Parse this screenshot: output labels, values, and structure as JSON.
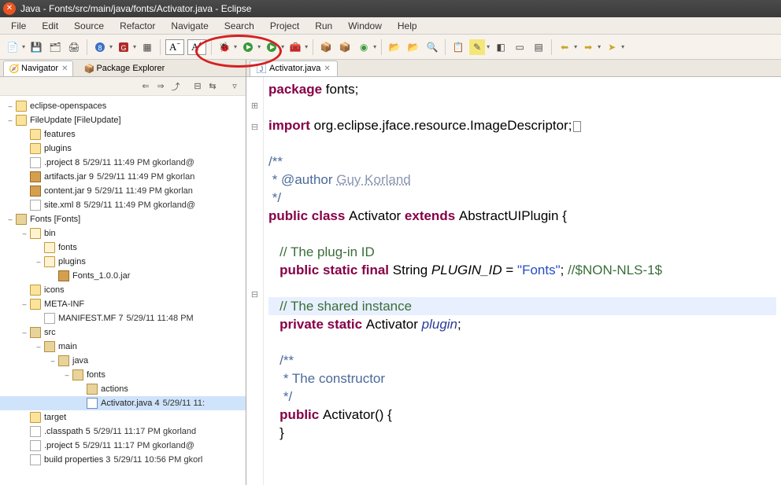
{
  "window": {
    "title": "Java - Fonts/src/main/java/fonts/Activator.java - Eclipse"
  },
  "menu": [
    "File",
    "Edit",
    "Source",
    "Refactor",
    "Navigate",
    "Search",
    "Project",
    "Run",
    "Window",
    "Help"
  ],
  "views": {
    "navigator": "Navigator",
    "package_explorer": "Package Explorer"
  },
  "editor_tab": {
    "label": "Activator.java"
  },
  "tree": [
    {
      "d": 0,
      "tw": "–",
      "ic": "folder",
      "label": "eclipse-openspaces"
    },
    {
      "d": 0,
      "tw": "–",
      "ic": "folder",
      "label": "FileUpdate [FileUpdate]"
    },
    {
      "d": 1,
      "tw": "",
      "ic": "folder",
      "label": "features"
    },
    {
      "d": 1,
      "tw": "",
      "ic": "folder",
      "label": "plugins"
    },
    {
      "d": 1,
      "tw": "",
      "ic": "file",
      "label": ".project 8",
      "meta": "5/29/11 11:49 PM  gkorland@"
    },
    {
      "d": 1,
      "tw": "",
      "ic": "jar",
      "label": "artifacts.jar 9",
      "meta": "5/29/11 11:49 PM  gkorlan"
    },
    {
      "d": 1,
      "tw": "",
      "ic": "jar",
      "label": "content.jar 9",
      "meta": "5/29/11 11:49 PM  gkorlan"
    },
    {
      "d": 1,
      "tw": "",
      "ic": "file",
      "label": "site.xml 8",
      "meta": "5/29/11 11:49 PM  gkorland@"
    },
    {
      "d": 0,
      "tw": "–",
      "ic": "pkg",
      "label": "Fonts [Fonts]"
    },
    {
      "d": 1,
      "tw": "–",
      "ic": "folder open",
      "label": "bin"
    },
    {
      "d": 2,
      "tw": "",
      "ic": "folder open",
      "label": "fonts"
    },
    {
      "d": 2,
      "tw": "–",
      "ic": "folder open",
      "label": "plugins"
    },
    {
      "d": 3,
      "tw": "",
      "ic": "jar",
      "label": "Fonts_1.0.0.jar"
    },
    {
      "d": 1,
      "tw": "",
      "ic": "folder",
      "label": "icons"
    },
    {
      "d": 1,
      "tw": "–",
      "ic": "folder",
      "label": "META-INF"
    },
    {
      "d": 2,
      "tw": "",
      "ic": "file",
      "label": "MANIFEST.MF 7",
      "meta": "5/29/11 11:48 PM"
    },
    {
      "d": 1,
      "tw": "–",
      "ic": "pkg",
      "label": "src"
    },
    {
      "d": 2,
      "tw": "–",
      "ic": "pkg",
      "label": "main"
    },
    {
      "d": 3,
      "tw": "–",
      "ic": "pkg",
      "label": "java"
    },
    {
      "d": 4,
      "tw": "–",
      "ic": "pkg",
      "label": "fonts"
    },
    {
      "d": 5,
      "tw": "",
      "ic": "pkg",
      "label": "actions"
    },
    {
      "d": 5,
      "tw": "",
      "ic": "jfile",
      "label": "Activator.java 4",
      "meta": "5/29/11 11:",
      "sel": true
    },
    {
      "d": 1,
      "tw": "",
      "ic": "folder",
      "label": "target"
    },
    {
      "d": 1,
      "tw": "",
      "ic": "file",
      "label": ".classpath 5",
      "meta": "5/29/11 11:17 PM  gkorland"
    },
    {
      "d": 1,
      "tw": "",
      "ic": "file",
      "label": ".project 5",
      "meta": "5/29/11 11:17 PM  gkorland@"
    },
    {
      "d": 1,
      "tw": "",
      "ic": "file",
      "label": "build properties 3",
      "meta": "5/29/11 10:56 PM  gkorl"
    }
  ],
  "code": {
    "pkg_kw": "package",
    "pkg_nm": " fonts;",
    "imp_kw": "import",
    "imp_nm": " org.eclipse.jface.resource.ImageDescriptor;",
    "jd1_open": "/**",
    "jd1_auth": " * @author ",
    "jd1_name": "Guy Korland",
    "jd1_close": " */",
    "cls_pub": "public class ",
    "cls_name": "Activator ",
    "cls_ext": "extends ",
    "cls_super": "AbstractUIPlugin {",
    "cm_plugid": "// The plug-in ID",
    "psf": "public static final ",
    "str": "String ",
    "pid": "PLUGIN_ID",
    "eq": " = ",
    "lit": "\"Fonts\"",
    "semi": "; ",
    "nls": "//$NON-NLS-1$",
    "cm_shared": "// The shared instance",
    "prs": "private static ",
    "act": "Activator ",
    "plg": "plugin",
    "semi2": ";",
    "jd2_open": "/**",
    "jd2_body": " * The constructor",
    "jd2_close": " */",
    "ctor_pub": "public ",
    "ctor_name": "Activator() {",
    "ctor_close": "}"
  }
}
